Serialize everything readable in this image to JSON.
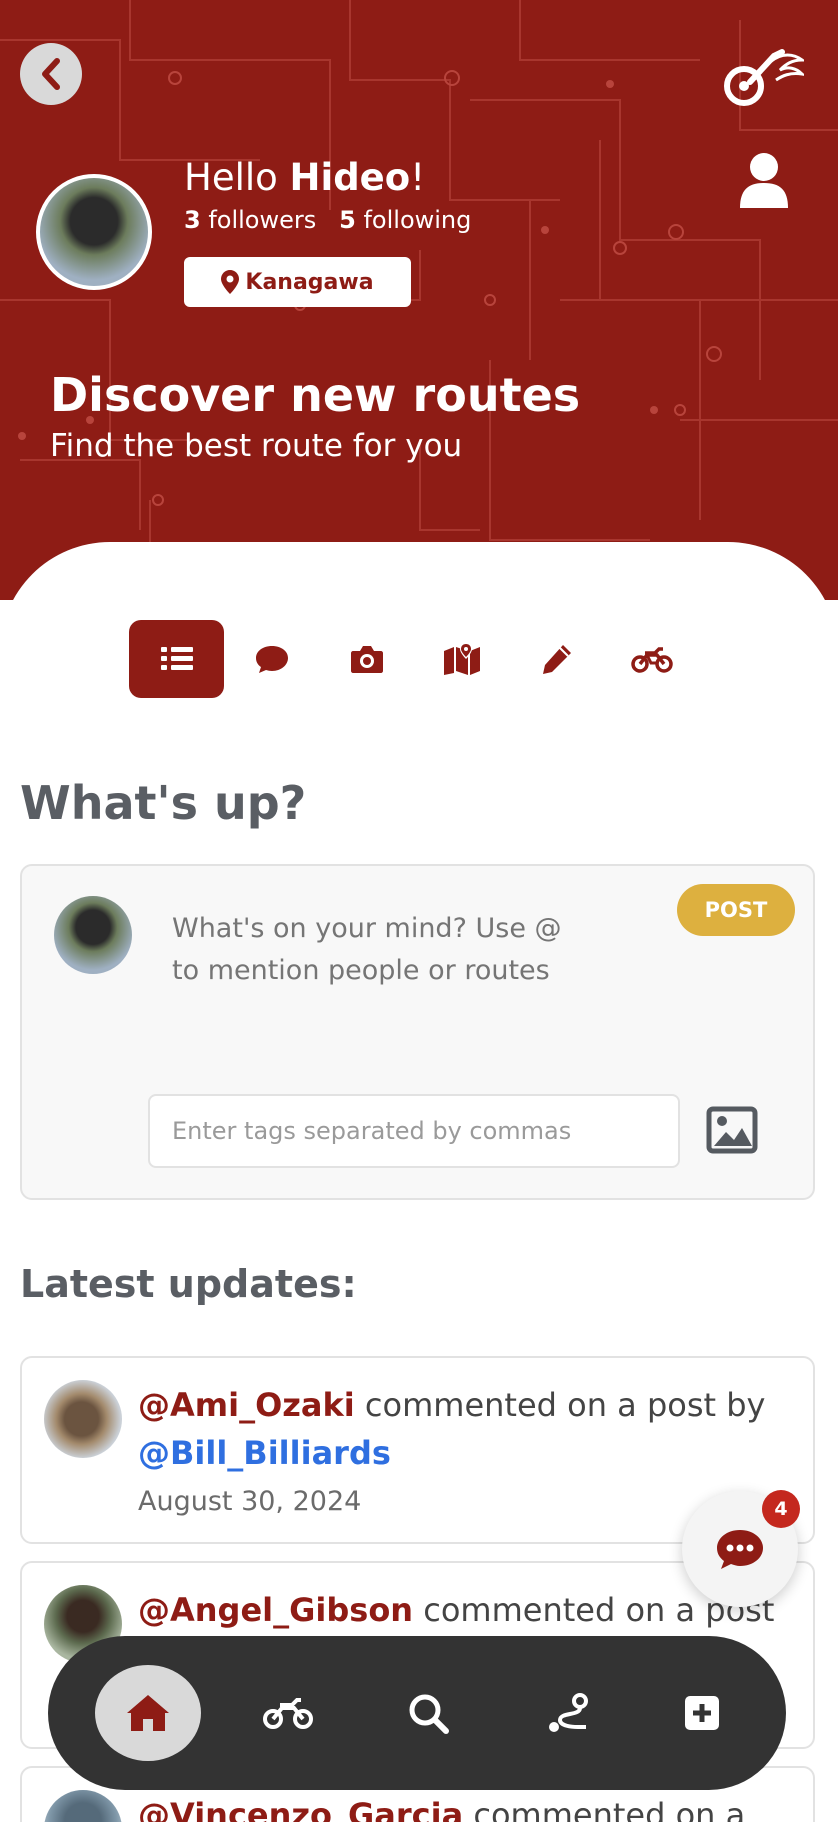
{
  "colors": {
    "primary": "#8e1c15",
    "accent_post": "#ddb03f",
    "link_blue": "#2f6fe0",
    "nav_bg": "#333333",
    "badge": "#c4281e"
  },
  "header": {
    "greeting_prefix": "Hello ",
    "user_name": "Hideo",
    "greeting_suffix": "!",
    "followers_count": "3",
    "followers_label": " followers",
    "following_count": "5",
    "following_label": " following",
    "location": "Kanagawa",
    "discover_title": "Discover new routes",
    "discover_subtitle": "Find the best route for you",
    "icons": {
      "back": "chevron-left-icon",
      "logo": "motorcycle-logo-icon",
      "profile": "user-icon"
    }
  },
  "tabs": [
    {
      "icon": "list-icon",
      "active": true
    },
    {
      "icon": "comment-icon",
      "active": false
    },
    {
      "icon": "camera-icon",
      "active": false
    },
    {
      "icon": "map-icon",
      "active": false
    },
    {
      "icon": "pencil-icon",
      "active": false
    },
    {
      "icon": "motorcycle-icon",
      "active": false
    }
  ],
  "composer": {
    "heading": "What's up?",
    "placeholder": "What's on your mind? Use @ to mention people or routes",
    "post_label": "POST",
    "tags_placeholder": "Enter tags separated by commas",
    "image_icon": "image-icon"
  },
  "feed": {
    "heading": "Latest updates:",
    "items": [
      {
        "user": "@Ami_Ozaki",
        "action": " commented on a post by",
        "target": "@Bill_Billiards",
        "date": "August 30, 2024"
      },
      {
        "user": "@Angel_Gibson",
        "action": " commented on a post"
      },
      {
        "user": "@Vincenzo_Garcia",
        "action": " commented on a"
      }
    ]
  },
  "chat": {
    "icon": "chat-bubble-icon",
    "badge_count": "4"
  },
  "bottom_nav": [
    {
      "icon": "home-icon",
      "active": true
    },
    {
      "icon": "motorcycle-icon",
      "active": false
    },
    {
      "icon": "search-icon",
      "active": false
    },
    {
      "icon": "route-icon",
      "active": false
    },
    {
      "icon": "plus-square-icon",
      "active": false
    }
  ]
}
